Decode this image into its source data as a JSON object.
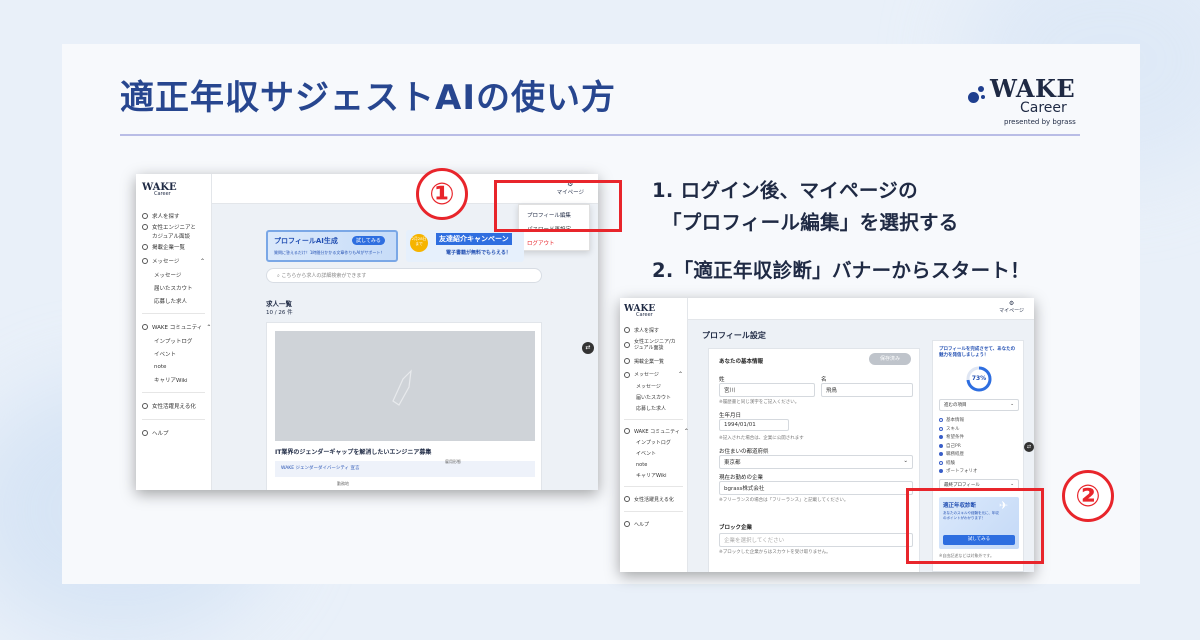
{
  "slide": {
    "title": "適正年収サジェストAIの使い方",
    "brand": {
      "name": "WAKE",
      "sub": "Career",
      "by": "presented by bgrass"
    },
    "steps": [
      "1. ログイン後、マイページの",
      "「プロフィール編集」を選択する",
      "2.「適正年収診断」バナーからスタート！"
    ],
    "badges": [
      "①",
      "②"
    ],
    "colors": {
      "title": "#27468f",
      "accent_red": "#e8252b",
      "brand_blue": "#1f3f8f"
    }
  },
  "shot1": {
    "logo": {
      "name": "WAKE",
      "sub": "Career"
    },
    "nav": [
      {
        "label": "求人を探す",
        "icon": "search-icon"
      },
      {
        "label": "女性エンジニアと",
        "icon": "people-icon"
      },
      {
        "label": "カジュアル面談",
        "icon": ""
      },
      {
        "label": "掲載企業一覧",
        "icon": "building-icon"
      },
      {
        "label": "メッセージ",
        "icon": "chat-icon"
      }
    ],
    "nav_sub1": [
      "メッセージ",
      "届いたスカウト",
      "応募した求人"
    ],
    "nav_community": "WAKE コミュニティ",
    "nav_sub2": [
      "インプットログ",
      "イベント",
      "note",
      "キャリアWiki"
    ],
    "nav_bottom": [
      "女性活躍見える化",
      "ヘルプ"
    ],
    "mypage_label": "マイページ",
    "menu": [
      "プロフィール編集",
      "パスワード再設定",
      "ログアウト"
    ],
    "banner1": {
      "title": "プロフィールAI生成",
      "button": "試してみる",
      "desc": "質問に答えるだけ！1時間分かかる文章作りもAIがサポート！"
    },
    "banner2": {
      "date": "2月28日まで",
      "title": "友達紹介キャンペーン",
      "sub": "電子書籍が無料でもらえる！"
    },
    "search_placeholder": "こちらから求人の詳細検索ができます",
    "list_title": "求人一覧",
    "list_count": "10 / 26 件",
    "job_title": "IT業界のジェンダーギャップを解消したいエンジニア募集",
    "job_tag": "WAKE ジェンダーダイバーシティ 宣言",
    "job_meta": [
      "雇用形態",
      "勤務地"
    ]
  },
  "shot2": {
    "logo": {
      "name": "WAKE",
      "sub": "Career"
    },
    "mypage_label": "マイページ",
    "page_title": "プロフィール設定",
    "nav": [
      "求人を探す",
      "女性エンジニア/カジュアル面談",
      "掲載企業一覧",
      "メッセージ"
    ],
    "nav_sub1": [
      "メッセージ",
      "届いたスカウト",
      "応募した求人"
    ],
    "nav_community": "WAKE コミュニティ",
    "nav_sub2": [
      "インプットログ",
      "イベント",
      "note",
      "キャリアWiki"
    ],
    "nav_bottom": [
      "女性活躍見える化",
      "ヘルプ"
    ],
    "section": "あなたの基本情報",
    "saved": "保存済み",
    "last_name_label": "姓",
    "last_name": "宮川",
    "first_name_label": "名",
    "first_name": "飛鳥",
    "note_name": "※履歴書と同じ漢字をご記入ください。",
    "birth_label": "生年月日",
    "birth": "1994/01/01",
    "note_birth": "※記入された場合は、企業に公開されます",
    "address_label": "お住まいの都道府県",
    "address": "東京都",
    "company_label": "現在お勤めの企業",
    "company": "bgrass株式会社",
    "note_company": "※フリーランスの場合は「フリーランス」と記載してください。",
    "block_label": "ブロック企業",
    "block_placeholder": "企業を選択してください",
    "note_block": "※ブロックした企業からはスカウトを受け取りません。",
    "side_title": "プロフィールを完成させて、あなたの魅力を発信しましょう！",
    "progress_percent": 73,
    "progress_label": "73%",
    "checklist_head": "進むの項目",
    "checklist": [
      "基本情報",
      "スキル",
      "希望条件",
      "自己PR",
      "職務経歴",
      "経験",
      "ポートフォリオ"
    ],
    "checklist_on": [
      false,
      false,
      true,
      true,
      true,
      false,
      true
    ],
    "checklist_more": "最終プロフィール",
    "ai_title": "適正年収診断",
    "ai_desc": "あなたのスキルや経験を元に、年収のポイントがわかります！",
    "ai_button": "試してみる",
    "ai_note": "※自由記述などは対象外です。"
  }
}
